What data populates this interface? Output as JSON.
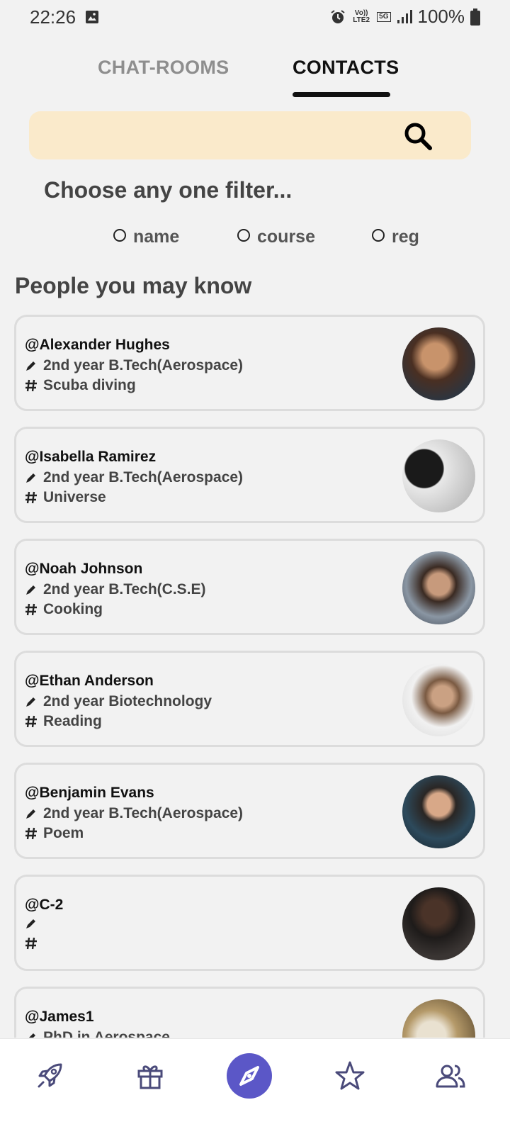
{
  "status_bar": {
    "time": "22:26",
    "network_top": "Vo)) LTE2",
    "network_5g": "5G",
    "battery": "100%"
  },
  "tabs": [
    {
      "label": "CHAT-ROOMS",
      "active": false
    },
    {
      "label": "CONTACTS",
      "active": true
    }
  ],
  "search": {
    "placeholder": "",
    "icon": "search-icon"
  },
  "filter": {
    "title": "Choose any one filter...",
    "options": [
      "name",
      "course",
      "reg"
    ]
  },
  "section_title": "People you may know",
  "contacts": [
    {
      "handle": "@Alexander Hughes",
      "course": "2nd year B.Tech(Aerospace)",
      "interest": "Scuba diving",
      "avatar_color": "#7a4e2d"
    },
    {
      "handle": "@Isabella Ramirez",
      "course": "2nd year B.Tech(Aerospace)",
      "interest": "Universe",
      "avatar_color": "#9a9a9a"
    },
    {
      "handle": "@Noah Johnson",
      "course": "2nd year B.Tech(C.S.E)",
      "interest": "Cooking",
      "avatar_color": "#6b5a4c"
    },
    {
      "handle": "@Ethan Anderson",
      "course": "2nd year Biotechnology",
      "interest": "Reading",
      "avatar_color": "#d8d8d8"
    },
    {
      "handle": "@Benjamin Evans",
      "course": "2nd year B.Tech(Aerospace)",
      "interest": "Poem",
      "avatar_color": "#1f3442"
    },
    {
      "handle": "@C-2",
      "course": "",
      "interest": "",
      "avatar_color": "#2b2726"
    },
    {
      "handle": "@James1",
      "course": "PhD in Aerospace",
      "interest": "",
      "avatar_color": "#c7b28a"
    }
  ],
  "bottom_nav": [
    {
      "icon": "rocket-icon"
    },
    {
      "icon": "gift-icon"
    },
    {
      "icon": "compass-icon",
      "active": true
    },
    {
      "icon": "star-icon"
    },
    {
      "icon": "people-icon"
    }
  ],
  "colors": {
    "accent": "#5b57c7",
    "search_bg": "#faeacb",
    "background": "#f2f2f2"
  }
}
